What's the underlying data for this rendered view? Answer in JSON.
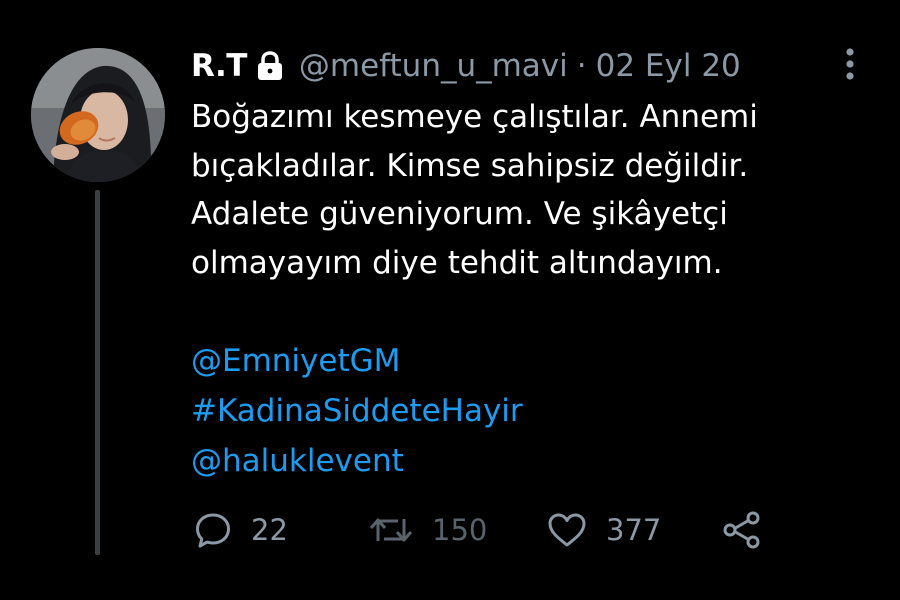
{
  "tweet": {
    "display_name": "R.T",
    "handle": "@meftun_u_mavi",
    "separator": "·",
    "date": "02 Eyl 20",
    "body_lines": [
      "Boğazımı kesmeye çalıştılar. Annemi",
      "bıçakladılar. Kimse sahipsiz değildir.",
      "Adalete güveniyorum. Ve şikâyetçi",
      "olmayayım diye tehdit altındayım."
    ],
    "links": [
      "@EmniyetGM",
      "#KadinaSiddeteHayir",
      "@haluklevent"
    ],
    "counts": {
      "replies": "22",
      "retweets": "150",
      "likes": "377"
    }
  },
  "icons": {
    "lock": "lock-icon",
    "more": "more-vertical-icon",
    "reply": "reply-bubble-icon",
    "retweet": "retweet-icon",
    "like": "heart-icon",
    "share": "share-icon"
  },
  "colors": {
    "background": "#000000",
    "text": "#ffffff",
    "muted": "#8b98a5",
    "link": "#1d9bf0",
    "thread_line": "#3b3f44"
  }
}
